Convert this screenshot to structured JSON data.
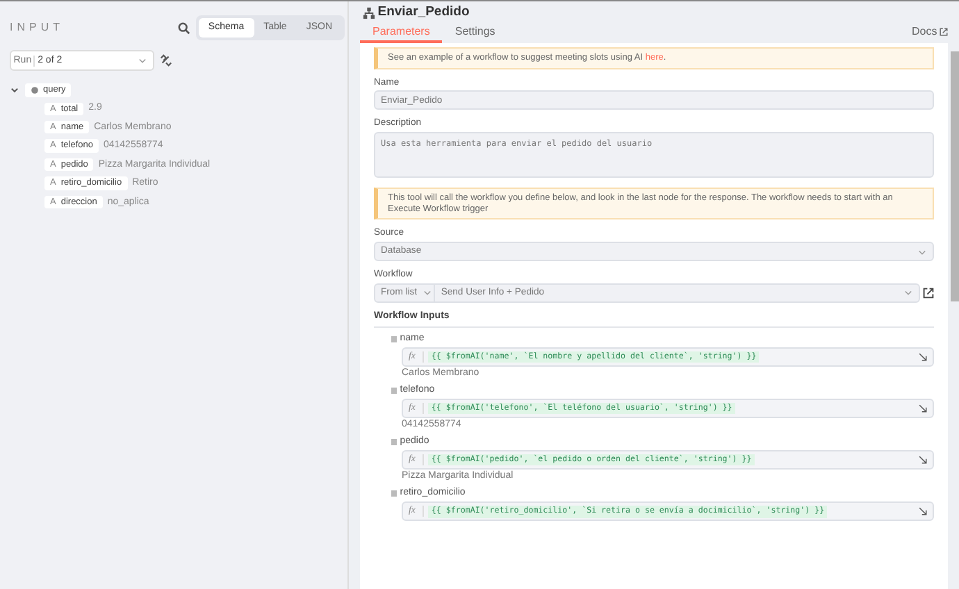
{
  "input_panel": {
    "title": "INPUT",
    "view_tabs": [
      {
        "label": "Schema",
        "selected": true
      },
      {
        "label": "Table",
        "selected": false
      },
      {
        "label": "JSON",
        "selected": false
      }
    ],
    "run_label": "Run",
    "run_value": "2 of 2",
    "tree": {
      "label": "query",
      "expanded": true,
      "children": [
        {
          "type_label": "A",
          "key": "total",
          "value": "2.9"
        },
        {
          "type_label": "A",
          "key": "name",
          "value": "Carlos Membrano"
        },
        {
          "type_label": "A",
          "key": "telefono",
          "value": "04142558774"
        },
        {
          "type_label": "A",
          "key": "pedido",
          "value": "Pizza Margarita Individual"
        },
        {
          "type_label": "A",
          "key": "retiro_domicilio",
          "value": "Retiro"
        },
        {
          "type_label": "A",
          "key": "direccion",
          "value": "no_aplica"
        }
      ]
    }
  },
  "node_panel": {
    "title": "Enviar_Pedido",
    "tabs": [
      {
        "label": "Parameters",
        "selected": true
      },
      {
        "label": "Settings",
        "selected": false
      }
    ],
    "docs_link": "Docs",
    "notice": {
      "text": "See an example of a workflow to suggest meeting slots using AI ",
      "link": "here",
      "end": "."
    },
    "name_label": "Name",
    "name_value": "Enviar_Pedido",
    "description_label": "Description",
    "description_value": "Usa esta herramienta para enviar el pedido del usuario",
    "notice_2": "This tool will call the workflow you define below, and look in the last node for the response. The workflow needs to start with an Execute Workflow trigger",
    "source_label": "Source",
    "source_value": "Database",
    "workflow_label": "Workflow",
    "workflow_mode": "From list",
    "workflow_value": "Send User Info + Pedido",
    "inputs_heading": "Workflow Inputs",
    "inputs": [
      {
        "name": "name",
        "fx_label": "fx",
        "expression": "{{ $fromAI('name', `El nombre y apellido del cliente`, 'string') }}",
        "result": "Carlos Membrano"
      },
      {
        "name": "telefono",
        "fx_label": "fx",
        "expression": "{{ $fromAI('telefono', `El teléfono del usuario`, 'string') }}",
        "result": "04142558774"
      },
      {
        "name": "pedido",
        "fx_label": "fx",
        "expression": "{{ $fromAI('pedido', `el pedido o orden del cliente`, 'string') }}",
        "result": "Pizza Margarita Individual"
      },
      {
        "name": "retiro_domicilio",
        "fx_label": "fx",
        "expression": "{{ $fromAI('retiro_domicilio', `Si retira o se envía a docimicilio`, 'string') }}"
      }
    ]
  }
}
